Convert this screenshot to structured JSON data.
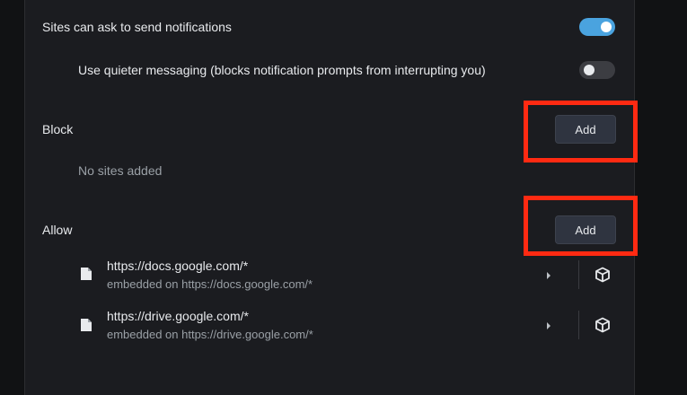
{
  "notifications": {
    "ask_label": "Sites can ask to send notifications",
    "ask_enabled": true,
    "quiet_label": "Use quieter messaging (blocks notification prompts from interrupting you)",
    "quiet_enabled": false
  },
  "block": {
    "heading": "Block",
    "add_label": "Add",
    "empty_text": "No sites added"
  },
  "allow": {
    "heading": "Allow",
    "add_label": "Add",
    "sites": [
      {
        "url": "https://docs.google.com/*",
        "embedded": "embedded on https://docs.google.com/*"
      },
      {
        "url": "https://drive.google.com/*",
        "embedded": "embedded on https://drive.google.com/*"
      }
    ]
  },
  "colors": {
    "highlight": "#ff2a12",
    "toggle_on": "#4aa3df",
    "panel_bg": "#1b1c20"
  }
}
